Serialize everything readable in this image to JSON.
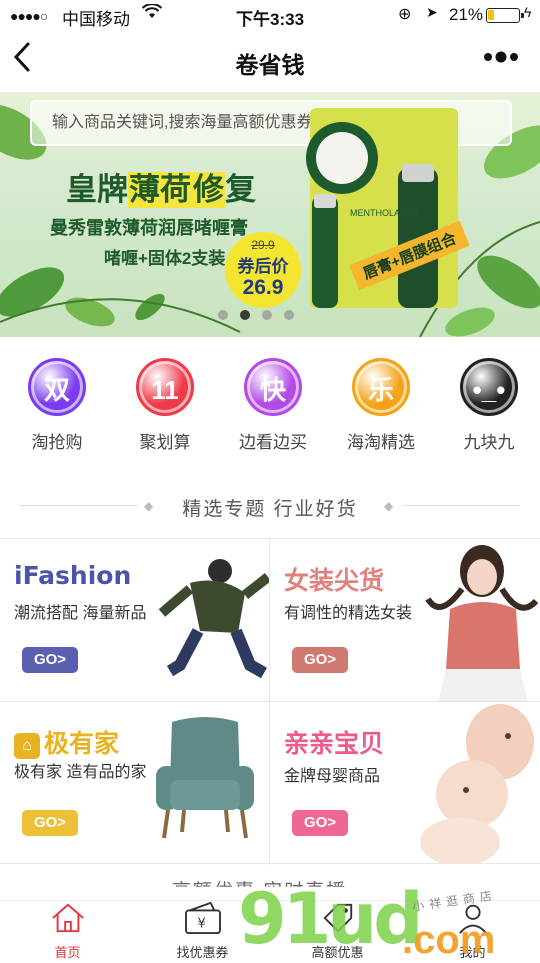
{
  "status": {
    "signal": "●●●●○",
    "carrier": "中国移动",
    "time": "下午3:33",
    "battery_pct": "21%",
    "battery_level": 0.21
  },
  "nav": {
    "title": "卷省钱"
  },
  "banner": {
    "search_placeholder": "输入商品关键词,搜索海量高额优惠券~",
    "headline_a": "皇牌",
    "headline_b": "薄荷",
    "headline_c": "修",
    "headline_d": "复",
    "sub1": "曼秀雷敦薄荷润唇啫喱膏",
    "sub2": "啫喱+固体2支装",
    "old_price": "29.9",
    "price_tag": "券后价",
    "new_price": "26.9",
    "ribbon": "唇膏+唇膜组合",
    "product_brand": "MENTHOLATUM",
    "active_dot": 1,
    "dot_count": 4
  },
  "categories": [
    {
      "label": "淘抢购",
      "glyph": "双",
      "color": "#7b3cf0"
    },
    {
      "label": "聚划算",
      "glyph": "11",
      "color": "#ef3a4a"
    },
    {
      "label": "边看边买",
      "glyph": "快",
      "color": "#b14ae6"
    },
    {
      "label": "海淘精选",
      "glyph": "乐",
      "color": "#f5a316"
    },
    {
      "label": "九块九",
      "glyph": "•_•",
      "color": "#222222"
    }
  ],
  "section_title": "精选专题  行业好货",
  "tiles": [
    {
      "title": "iFashion",
      "desc": "潮流搭配 海量新品",
      "go": "GO>",
      "title_color": "#4a54a8",
      "btn_color": "#5a5fb0"
    },
    {
      "title": "女装尖货",
      "desc": "有调性的精选女装",
      "go": "GO>",
      "title_color": "#e0827a",
      "btn_color": "#d07970"
    },
    {
      "title": "极有家",
      "desc": "极有家 造有品的家",
      "go": "GO>",
      "title_color": "#e8b323",
      "btn_color": "#edc036"
    },
    {
      "title": "亲亲宝贝",
      "desc": "金牌母婴商品",
      "go": "GO>",
      "title_color": "#ee5a8c",
      "btn_color": "#f06796"
    }
  ],
  "peek_text": "高额优惠 实时直播",
  "tabs": [
    {
      "label": "首页",
      "active": true
    },
    {
      "label": "找优惠券",
      "active": false
    },
    {
      "label": "高额优惠",
      "active": false
    },
    {
      "label": "我的",
      "active": false
    }
  ],
  "watermark": {
    "a": "91ud",
    "b": ".com",
    "c": "小祥逛商店"
  }
}
